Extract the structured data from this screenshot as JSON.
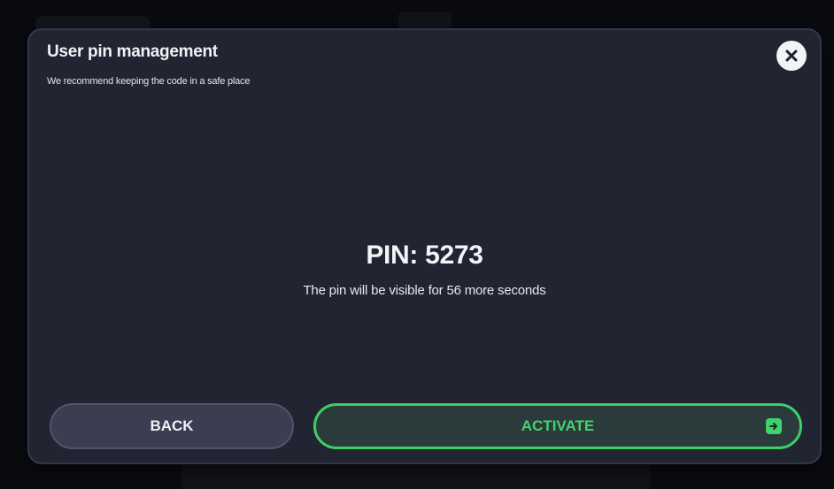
{
  "dialog": {
    "title": "User pin management",
    "subtitle": "We recommend keeping the code in a safe place",
    "close_icon": "close-icon"
  },
  "pin": {
    "label": "PIN: 5273",
    "note": "The pin will be visible for 56 more seconds"
  },
  "actions": {
    "back_label": "BACK",
    "activate_label": "ACTIVATE",
    "activate_icon": "arrow-right-icon"
  },
  "colors": {
    "dialog_background": "#212431",
    "accent_green": "#3ecf6a",
    "back_button": "#3a3e50"
  }
}
